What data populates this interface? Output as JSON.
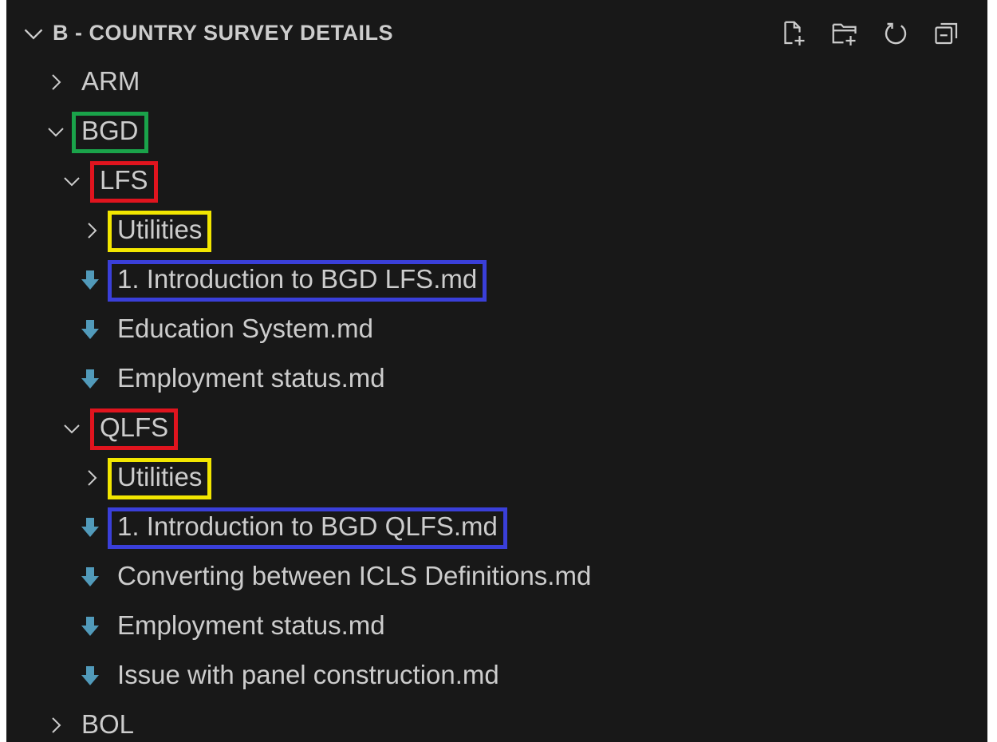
{
  "explorer": {
    "section_title": "B - COUNTRY SURVEY DETAILS",
    "actions": [
      {
        "name": "new-file",
        "icon": "new-file-icon"
      },
      {
        "name": "new-folder",
        "icon": "new-folder-icon"
      },
      {
        "name": "refresh",
        "icon": "refresh-icon"
      },
      {
        "name": "collapse-all",
        "icon": "collapse-all-icon"
      }
    ],
    "tree": [
      {
        "label": "ARM",
        "kind": "folder",
        "expanded": false,
        "depth": 0
      },
      {
        "label": "BGD",
        "kind": "folder",
        "expanded": true,
        "depth": 0,
        "highlight": "green"
      },
      {
        "label": "LFS",
        "kind": "folder",
        "expanded": true,
        "depth": 1,
        "highlight": "red"
      },
      {
        "label": "Utilities",
        "kind": "folder",
        "expanded": false,
        "depth": 2,
        "highlight": "yellow"
      },
      {
        "label": "1. Introduction to BGD LFS.md",
        "kind": "markdown",
        "depth": 2,
        "highlight": "blue"
      },
      {
        "label": "Education System.md",
        "kind": "markdown",
        "depth": 2
      },
      {
        "label": "Employment status.md",
        "kind": "markdown",
        "depth": 2
      },
      {
        "label": "QLFS",
        "kind": "folder",
        "expanded": true,
        "depth": 1,
        "highlight": "red"
      },
      {
        "label": "Utilities",
        "kind": "folder",
        "expanded": false,
        "depth": 2,
        "highlight": "yellow"
      },
      {
        "label": "1. Introduction to BGD QLFS.md",
        "kind": "markdown",
        "depth": 2,
        "highlight": "blue"
      },
      {
        "label": "Converting between ICLS Definitions.md",
        "kind": "markdown",
        "depth": 2
      },
      {
        "label": "Employment status.md",
        "kind": "markdown",
        "depth": 2
      },
      {
        "label": "Issue with panel construction.md",
        "kind": "markdown",
        "depth": 2
      },
      {
        "label": "BOL",
        "kind": "folder",
        "expanded": false,
        "depth": 0
      }
    ]
  },
  "colors": {
    "background": "#181818",
    "text": "#cccccc",
    "markdown_icon": "#519aba",
    "highlight_green": "#1aa34a",
    "highlight_red": "#e0141e",
    "highlight_yellow": "#f2e600",
    "highlight_blue": "#3a3fd9"
  }
}
